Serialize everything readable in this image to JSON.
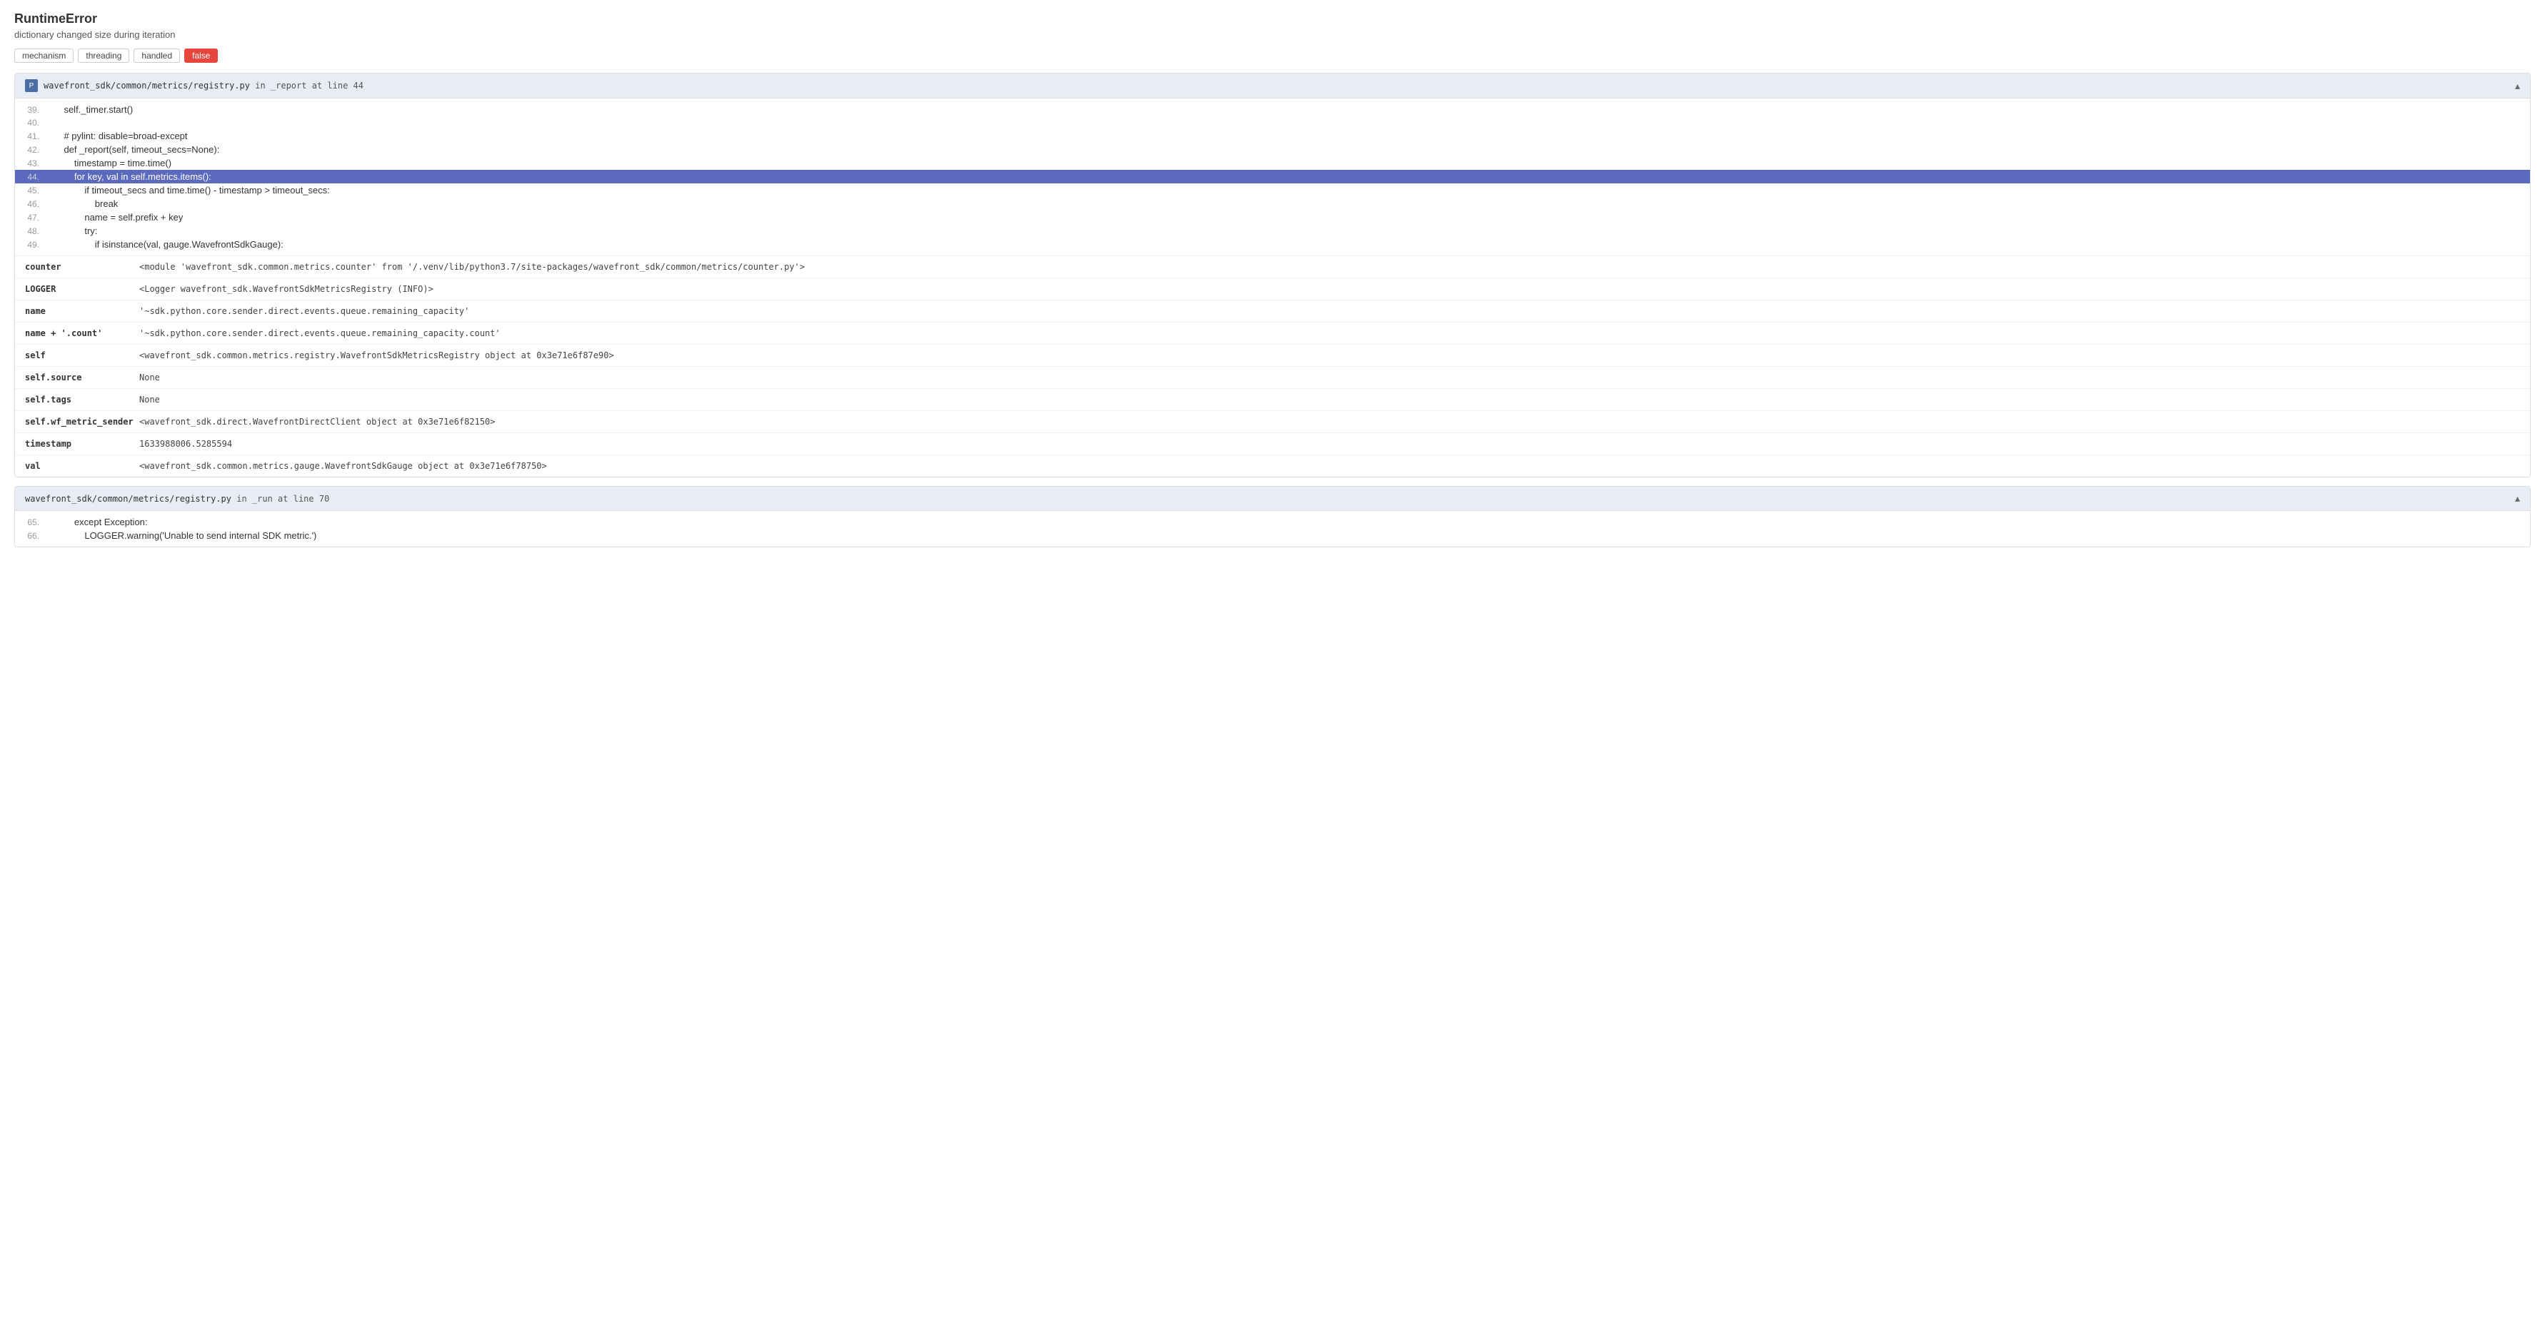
{
  "error": {
    "title": "RuntimeError",
    "subtitle": "dictionary changed size during iteration"
  },
  "tags": [
    {
      "id": "mechanism",
      "label": "mechanism",
      "active": false
    },
    {
      "id": "threading",
      "label": "threading",
      "active": false
    },
    {
      "id": "handled",
      "label": "handled",
      "active": false
    },
    {
      "id": "false",
      "label": "false",
      "active": true
    }
  ],
  "frame1": {
    "path": "wavefront_sdk/common/metrics/registry.py",
    "in_keyword": "in",
    "function": "_report",
    "at_keyword": "at line",
    "lineno": "44",
    "icon_label": "P",
    "code_lines": [
      {
        "num": "39.",
        "code": "    self._timer.start()",
        "highlighted": false
      },
      {
        "num": "40.",
        "code": "",
        "highlighted": false
      },
      {
        "num": "41.",
        "code": "    # pylint: disable=broad-except",
        "highlighted": false
      },
      {
        "num": "42.",
        "code": "    def _report(self, timeout_secs=None):",
        "highlighted": false
      },
      {
        "num": "43.",
        "code": "        timestamp = time.time()",
        "highlighted": false
      },
      {
        "num": "44.",
        "code": "        for key, val in self.metrics.items():",
        "highlighted": true
      },
      {
        "num": "45.",
        "code": "            if timeout_secs and time.time() - timestamp > timeout_secs:",
        "highlighted": false
      },
      {
        "num": "46.",
        "code": "                break",
        "highlighted": false
      },
      {
        "num": "47.",
        "code": "            name = self.prefix + key",
        "highlighted": false
      },
      {
        "num": "48.",
        "code": "            try:",
        "highlighted": false
      },
      {
        "num": "49.",
        "code": "                if isinstance(val, gauge.WavefrontSdkGauge):",
        "highlighted": false
      }
    ],
    "variables": [
      {
        "name": "counter",
        "value": "<module 'wavefront_sdk.common.metrics.counter' from '/.venv/lib/python3.7/site-packages/wavefront_sdk/common/metrics/counter.py'>"
      },
      {
        "name": "LOGGER",
        "value": "<Logger wavefront_sdk.WavefrontSdkMetricsRegistry (INFO)>"
      },
      {
        "name": "name",
        "value": "'~sdk.python.core.sender.direct.events.queue.remaining_capacity'"
      },
      {
        "name": "name + '.count'",
        "value": "'~sdk.python.core.sender.direct.events.queue.remaining_capacity.count'"
      },
      {
        "name": "self",
        "value": "<wavefront_sdk.common.metrics.registry.WavefrontSdkMetricsRegistry object at 0x3e71e6f87e90>"
      },
      {
        "name": "self.source",
        "value": "None"
      },
      {
        "name": "self.tags",
        "value": "None"
      },
      {
        "name": "self.wf_metric_sender",
        "value": "<wavefront_sdk.direct.WavefrontDirectClient object at 0x3e71e6f82150>"
      },
      {
        "name": "timestamp",
        "value": "1633988006.5285594"
      },
      {
        "name": "val",
        "value": "<wavefront_sdk.common.metrics.gauge.WavefrontSdkGauge object at 0x3e71e6f78750>"
      }
    ]
  },
  "frame2": {
    "path": "wavefront_sdk/common/metrics/registry.py",
    "in_keyword": "in",
    "function": "_run",
    "at_keyword": "at line",
    "lineno": "70",
    "code_lines": [
      {
        "num": "65.",
        "code": "        except Exception:",
        "highlighted": false
      },
      {
        "num": "66.",
        "code": "            LOGGER.warning('Unable to send internal SDK metric.')",
        "highlighted": false
      }
    ]
  }
}
